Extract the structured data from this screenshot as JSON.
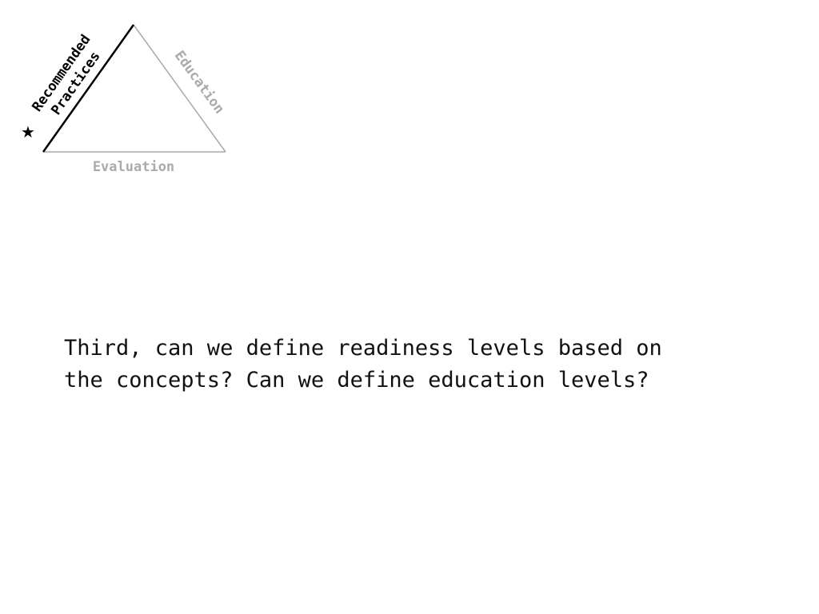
{
  "diagram": {
    "sides": {
      "left": {
        "line1": "Recommended",
        "line2": "Practices",
        "highlighted": true
      },
      "right": {
        "label": "Education",
        "highlighted": false
      },
      "bottom": {
        "label": "Evaluation",
        "highlighted": false
      }
    },
    "marker_icon": "star-icon",
    "colors": {
      "active": "#000000",
      "inactive": "#aaaaaa"
    }
  },
  "slide": {
    "lines": [
      "Third, can we define readiness levels based on",
      "the concepts? Can we define education levels?"
    ]
  }
}
